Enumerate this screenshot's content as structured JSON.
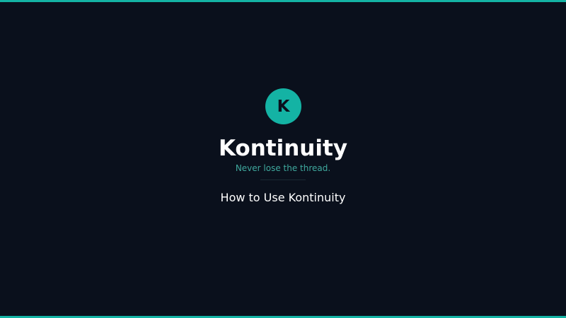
{
  "colors": {
    "background": "#0a101c",
    "accent": "#14b3a4",
    "tagline": "#3fa99e",
    "text": "#ffffff"
  },
  "logo": {
    "letter": "K",
    "icon": "brand-logo-icon"
  },
  "brand": {
    "title": "Kontinuity",
    "tagline": "Never lose the thread."
  },
  "slide": {
    "subtitle": "How to Use Kontinuity"
  }
}
